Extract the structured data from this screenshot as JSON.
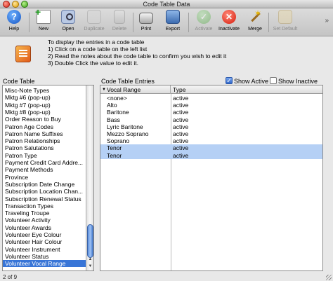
{
  "window": {
    "title": "Code Table Data"
  },
  "toolbar": {
    "buttons": [
      {
        "label": "Help",
        "icon": "help-icon",
        "enabled": true
      },
      {
        "label": "New",
        "icon": "new-document-icon",
        "enabled": true
      },
      {
        "label": "Open",
        "icon": "open-magnifier-icon",
        "enabled": true
      },
      {
        "label": "Duplicate",
        "icon": "duplicate-icon",
        "enabled": false
      },
      {
        "label": "Delete",
        "icon": "trash-icon",
        "enabled": false
      },
      {
        "label": "Print",
        "icon": "printer-icon",
        "enabled": true
      },
      {
        "label": "Export",
        "icon": "export-icon",
        "enabled": true
      },
      {
        "label": "Activate",
        "icon": "checkmark-icon",
        "enabled": false
      },
      {
        "label": "Inactivate",
        "icon": "x-circle-icon",
        "enabled": true
      },
      {
        "label": "Merge",
        "icon": "magic-wand-icon",
        "enabled": true
      },
      {
        "label": "Set Default",
        "icon": "set-default-icon",
        "enabled": false
      }
    ],
    "overflow_glyph": "»"
  },
  "instructions": {
    "line1": "To display the entries in a code table",
    "line2": "1) Click on a code table on the left list",
    "line3": "2) Read the notes about the code table to confirm you wish to edit it",
    "line4": "3) Double Click the value to edit it."
  },
  "code_table": {
    "label": "Code Table",
    "items": [
      "Misc-Note Types",
      "Mktg #6 (pop-up)",
      "Mktg #7 (pop-up)",
      "Mktg #8 (pop-up)",
      "Order Reason to Buy",
      "Patron Age Codes",
      "Patron Name Suffixes",
      "Patron Relationships",
      "Patron Salutations",
      "Patron Type",
      "Payment Credit Card Addre...",
      "Payment Methods",
      "Province",
      "Subscription Date Change",
      "Subscription Location Chan...",
      "Subscription Renewal Status",
      "Transaction Types",
      "Traveling Troupe",
      "Volunteer Activity",
      "Volunteer Awards",
      "Volunteer Eye Colour",
      "Volunteer Hair Colour",
      "Volunteer Instrument",
      "Volunteer Status",
      "Volunteer Vocal Range"
    ],
    "selected": "Volunteer Vocal Range"
  },
  "entries": {
    "label": "Code Table Entries",
    "show_active_label": "Show Active",
    "show_active_checked": true,
    "show_inactive_label": "Show Inactive",
    "show_inactive_checked": false,
    "columns": [
      "Vocal Range",
      "Type"
    ],
    "rows": [
      {
        "value": "<none>",
        "type": "active"
      },
      {
        "value": "Alto",
        "type": "active"
      },
      {
        "value": "Baritone",
        "type": "active"
      },
      {
        "value": "Bass",
        "type": "active"
      },
      {
        "value": "Lyric Baritone",
        "type": "active"
      },
      {
        "value": "Mezzo Soprano",
        "type": "active"
      },
      {
        "value": "Soprano",
        "type": "active"
      },
      {
        "value": "Tenor",
        "type": "active"
      },
      {
        "value": "Tenor",
        "type": "active"
      }
    ],
    "highlighted_rows": [
      7,
      8
    ]
  },
  "status": {
    "text": "2 of 9"
  },
  "colors": {
    "selection": "#3875d7",
    "row_highlight": "#b5d0f5"
  }
}
